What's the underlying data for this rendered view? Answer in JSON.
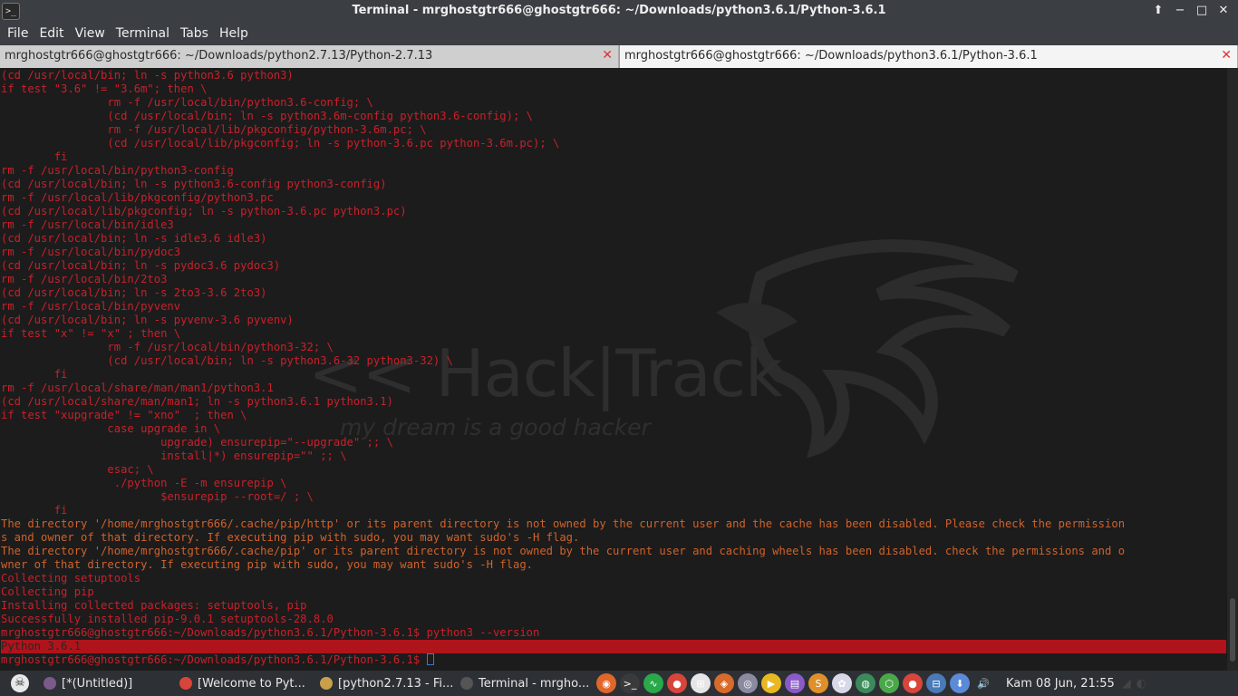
{
  "window": {
    "title": "Terminal - mrghostgtr666@ghostgtr666: ~/Downloads/python3.6.1/Python-3.6.1",
    "app_icon": ">_",
    "controls": {
      "up": "⬆",
      "minimize": "−",
      "maximize": "□",
      "close": "✕"
    }
  },
  "menu": [
    "File",
    "Edit",
    "View",
    "Terminal",
    "Tabs",
    "Help"
  ],
  "tabs": [
    {
      "label": "mrghostgtr666@ghostgtr666: ~/Downloads/python2.7.13/Python-2.7.13",
      "close": "✕",
      "active": false
    },
    {
      "label": "mrghostgtr666@ghostgtr666: ~/Downloads/python3.6.1/Python-3.6.1",
      "close": "✕",
      "active": true
    }
  ],
  "watermark": {
    "title": "<< Hack|Track",
    "subtitle": "my dream is a good hacker"
  },
  "terminal_lines": [
    {
      "text": "(cd /usr/local/bin; ln -s python3.6 python3)",
      "color": "red"
    },
    {
      "text": "if test \"3.6\" != \"3.6m\"; then \\",
      "color": "red"
    },
    {
      "text": "                rm -f /usr/local/bin/python3.6-config; \\",
      "color": "red"
    },
    {
      "text": "                (cd /usr/local/bin; ln -s python3.6m-config python3.6-config); \\",
      "color": "red"
    },
    {
      "text": "                rm -f /usr/local/lib/pkgconfig/python-3.6m.pc; \\",
      "color": "red"
    },
    {
      "text": "                (cd /usr/local/lib/pkgconfig; ln -s python-3.6.pc python-3.6m.pc); \\",
      "color": "red"
    },
    {
      "text": "        fi",
      "color": "red"
    },
    {
      "text": "rm -f /usr/local/bin/python3-config",
      "color": "red"
    },
    {
      "text": "(cd /usr/local/bin; ln -s python3.6-config python3-config)",
      "color": "red"
    },
    {
      "text": "rm -f /usr/local/lib/pkgconfig/python3.pc",
      "color": "red"
    },
    {
      "text": "(cd /usr/local/lib/pkgconfig; ln -s python-3.6.pc python3.pc)",
      "color": "red"
    },
    {
      "text": "rm -f /usr/local/bin/idle3",
      "color": "red"
    },
    {
      "text": "(cd /usr/local/bin; ln -s idle3.6 idle3)",
      "color": "red"
    },
    {
      "text": "rm -f /usr/local/bin/pydoc3",
      "color": "red"
    },
    {
      "text": "(cd /usr/local/bin; ln -s pydoc3.6 pydoc3)",
      "color": "red"
    },
    {
      "text": "rm -f /usr/local/bin/2to3",
      "color": "red"
    },
    {
      "text": "(cd /usr/local/bin; ln -s 2to3-3.6 2to3)",
      "color": "red"
    },
    {
      "text": "rm -f /usr/local/bin/pyvenv",
      "color": "red"
    },
    {
      "text": "(cd /usr/local/bin; ln -s pyvenv-3.6 pyvenv)",
      "color": "red"
    },
    {
      "text": "if test \"x\" != \"x\" ; then \\",
      "color": "red"
    },
    {
      "text": "                rm -f /usr/local/bin/python3-32; \\",
      "color": "red"
    },
    {
      "text": "                (cd /usr/local/bin; ln -s python3.6-32 python3-32) \\",
      "color": "red"
    },
    {
      "text": "        fi",
      "color": "red"
    },
    {
      "text": "rm -f /usr/local/share/man/man1/python3.1",
      "color": "red"
    },
    {
      "text": "(cd /usr/local/share/man/man1; ln -s python3.6.1 python3.1)",
      "color": "red"
    },
    {
      "text": "if test \"xupgrade\" != \"xno\"  ; then \\",
      "color": "red"
    },
    {
      "text": "                case upgrade in \\",
      "color": "red"
    },
    {
      "text": "                        upgrade) ensurepip=\"--upgrade\" ;; \\",
      "color": "red"
    },
    {
      "text": "                        install|*) ensurepip=\"\" ;; \\",
      "color": "red"
    },
    {
      "text": "                esac; \\",
      "color": "red"
    },
    {
      "text": "                 ./python -E -m ensurepip \\",
      "color": "red"
    },
    {
      "text": "                        $ensurepip --root=/ ; \\",
      "color": "red"
    },
    {
      "text": "        fi",
      "color": "red"
    },
    {
      "text": "The directory '/home/mrghostgtr666/.cache/pip/http' or its parent directory is not owned by the current user and the cache has been disabled. Please check the permission",
      "color": "orange"
    },
    {
      "text": "s and owner of that directory. If executing pip with sudo, you may want sudo's -H flag.",
      "color": "orange"
    },
    {
      "text": "The directory '/home/mrghostgtr666/.cache/pip' or its parent directory is not owned by the current user and caching wheels has been disabled. check the permissions and o",
      "color": "orange"
    },
    {
      "text": "wner of that directory. If executing pip with sudo, you may want sudo's -H flag.",
      "color": "orange"
    },
    {
      "text": "Collecting setuptools",
      "color": "red"
    },
    {
      "text": "Collecting pip",
      "color": "red"
    },
    {
      "text": "Installing collected packages: setuptools, pip",
      "color": "red"
    },
    {
      "text": "Successfully installed pip-9.0.1 setuptools-28.8.0",
      "color": "red"
    },
    {
      "text": "mrghostgtr666@ghostgtr666:~/Downloads/python3.6.1/Python-3.6.1$ python3 --version",
      "color": "red"
    },
    {
      "text": "Python 3.6.1",
      "color": "highlight"
    },
    {
      "text": "mrghostgtr666@ghostgtr666:~/Downloads/python3.6.1/Python-3.6.1$ ",
      "color": "red",
      "cursor": true
    }
  ],
  "taskbar": {
    "tasks": [
      {
        "label": "[*(Untitled)]",
        "icon": "editor-icon",
        "color": "#7a5a8a"
      },
      {
        "label": "[Welcome to Pyt...",
        "icon": "chrome-icon",
        "color": "#d8453a"
      },
      {
        "label": "[python2.7.13 - Fi...",
        "icon": "folder-icon",
        "color": "#c9a04a"
      },
      {
        "label": "Terminal - mrgho...",
        "icon": "terminal-icon",
        "color": "#555555"
      }
    ],
    "launchers": [
      {
        "icon": "firefox-icon",
        "color": "#e0662a",
        "glyph": "◉"
      },
      {
        "icon": "terminal-launcher-icon",
        "color": "#3a3a3a",
        "glyph": ">_"
      },
      {
        "icon": "system-monitor-icon",
        "color": "#2aa84a",
        "glyph": "∿"
      },
      {
        "icon": "chrome-launcher-icon",
        "color": "#d8453a",
        "glyph": "●"
      },
      {
        "icon": "network-icon",
        "color": "#e6e6e6",
        "glyph": "⊞"
      },
      {
        "icon": "game-icon",
        "color": "#d86a2a",
        "glyph": "◈"
      },
      {
        "icon": "disc-icon",
        "color": "#8a8aa0",
        "glyph": "◎"
      },
      {
        "icon": "media-player-icon",
        "color": "#e8b820",
        "glyph": "▶"
      },
      {
        "icon": "document-icon",
        "color": "#8a5ac8",
        "glyph": "▤"
      },
      {
        "icon": "sublime-icon",
        "color": "#e0902a",
        "glyph": "S"
      },
      {
        "icon": "bug-icon",
        "color": "#d8d8e8",
        "glyph": "✿"
      },
      {
        "icon": "globe-icon",
        "color": "#3a8a5a",
        "glyph": "◍"
      },
      {
        "icon": "package-icon",
        "color": "#4aa84a",
        "glyph": "⬡"
      },
      {
        "icon": "chrome-tray-icon",
        "color": "#d8453a",
        "glyph": "●"
      },
      {
        "icon": "network-tray-icon",
        "color": "#4a7ab8",
        "glyph": "⊟"
      },
      {
        "icon": "download-icon",
        "color": "#5a8ad8",
        "glyph": "⬇"
      },
      {
        "icon": "volume-icon",
        "color": "#2d3035",
        "glyph": "🔊"
      }
    ],
    "clock": "Kam 08 Jun, 21:55"
  }
}
